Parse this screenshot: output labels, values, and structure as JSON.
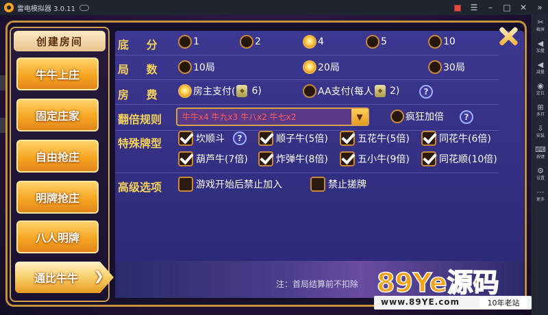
{
  "window": {
    "title": "雷电模拟器 3.0.11"
  },
  "toolbar": [
    {
      "icon": "scissors-icon",
      "glyph": "✂",
      "label": "截屏"
    },
    {
      "icon": "volume-up-icon",
      "glyph": "◀",
      "label": "加量"
    },
    {
      "icon": "volume-down-icon",
      "glyph": "◀",
      "label": "减量"
    },
    {
      "icon": "location-icon",
      "glyph": "◉",
      "label": "定位"
    },
    {
      "icon": "multi-open-icon",
      "glyph": "⊞",
      "label": "多开"
    },
    {
      "icon": "install-icon",
      "glyph": "⇩",
      "label": "安装"
    },
    {
      "icon": "keyboard-icon",
      "glyph": "⌨",
      "label": "按键"
    },
    {
      "icon": "settings-icon",
      "glyph": "⚙",
      "label": "设置"
    },
    {
      "icon": "more-icon",
      "glyph": "⋯",
      "label": "更多"
    }
  ],
  "sidebar": {
    "title": "创建房间",
    "modes": [
      "牛牛上庄",
      "固定庄家",
      "自由抢庄",
      "明牌抢庄",
      "八人明牌",
      "通比牛牛"
    ],
    "selected": "通比牛牛"
  },
  "form": {
    "base_score": {
      "label": "底 分",
      "options": [
        "1",
        "2",
        "4",
        "5",
        "10"
      ],
      "selected": "4"
    },
    "rounds": {
      "label": "局 数",
      "options": [
        "10局",
        "20局",
        "30局"
      ],
      "selected": "20局"
    },
    "fee": {
      "label": "房 费",
      "owner_pay": "房主支付(",
      "owner_cost": "6)",
      "aa_pay": "AA支付(每人",
      "aa_cost": "2)",
      "selected": "owner"
    },
    "multiplier": {
      "label": "翻倍规则",
      "value": "牛牛x4   牛九x3   牛八x2   牛七x2",
      "crazy": "疯狂加倍"
    },
    "special": {
      "label": "特殊牌型",
      "items": [
        "坎顺斗",
        "顺子牛(5倍)",
        "五花牛(5倍)",
        "同花牛(6倍)",
        "葫芦牛(7倍)",
        "炸弹牛(8倍)",
        "五小牛(9倍)",
        "同花顺(10倍)"
      ]
    },
    "advanced": {
      "label": "高级选项",
      "items": [
        "游戏开始后禁止加入",
        "禁止搓牌"
      ]
    }
  },
  "note": "注：首局结算前不扣除",
  "watermark": {
    "main": "89Ye源码",
    "url": "www.89YE.com",
    "tag": "10年老站"
  },
  "colors": {
    "label": "#f5d35b",
    "accent": "#f5a623",
    "panel": "#3c3790",
    "frame": "#c7923c"
  }
}
